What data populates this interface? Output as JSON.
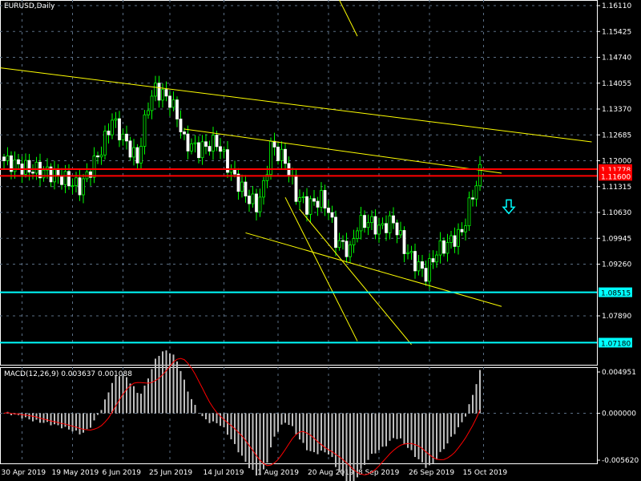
{
  "header": {
    "symbol_label": "EURUSD,Daily"
  },
  "macd": {
    "label": "MACD(12,26,9) 0.003637 0.001088",
    "axis": [
      "0.004951",
      "0.000000",
      "-0.005620"
    ],
    "range": [
      -0.00562,
      0.004951
    ]
  },
  "colors": {
    "bg": "#000000",
    "grid": "#5a6e84",
    "bull": "#00ff00",
    "bear": "#ffffff",
    "trend": "#ffff00",
    "support": "#00ffff",
    "resistance": "#ff0000",
    "signal": "#ff0000",
    "hist": "#c0c0c0"
  },
  "chart_data": {
    "type": "candlestick",
    "title": "EURUSD,Daily",
    "ylim": [
      1.0698,
      1.1625
    ],
    "price_ticks": [
      "1.16110",
      "1.15425",
      "1.14740",
      "1.14055",
      "1.13370",
      "1.12685",
      "1.12000",
      "1.11315",
      "1.10630",
      "1.09945",
      "1.09260",
      "1.07890"
    ],
    "date_ticks": [
      {
        "bar": 5,
        "label": "30 Apr 2019"
      },
      {
        "bar": 19,
        "label": "19 May 2019"
      },
      {
        "bar": 33,
        "label": "6 Jun 2019"
      },
      {
        "bar": 46,
        "label": "25 Jun 2019"
      },
      {
        "bar": 61,
        "label": "14 Jul 2019"
      },
      {
        "bar": 76,
        "label": "1 Aug 2019"
      },
      {
        "bar": 90,
        "label": "20 Aug 2019"
      },
      {
        "bar": 104,
        "label": "8 Sep 2019"
      },
      {
        "bar": 118,
        "label": "26 Sep 2019"
      },
      {
        "bar": 133,
        "label": "15 Oct 2019"
      }
    ],
    "close_path": [
      [
        0,
        1.12
      ],
      [
        6,
        1.118
      ],
      [
        12,
        1.117
      ],
      [
        17,
        1.115
      ],
      [
        21,
        1.113
      ],
      [
        23,
        1.116
      ],
      [
        27,
        1.123
      ],
      [
        30,
        1.131
      ],
      [
        33,
        1.126
      ],
      [
        37,
        1.12
      ],
      [
        40,
        1.135
      ],
      [
        42,
        1.139
      ],
      [
        46,
        1.136
      ],
      [
        48,
        1.132
      ],
      [
        50,
        1.125
      ],
      [
        54,
        1.123
      ],
      [
        59,
        1.125
      ],
      [
        63,
        1.117
      ],
      [
        67,
        1.111
      ],
      [
        70,
        1.108
      ],
      [
        72,
        1.113
      ],
      [
        74,
        1.124
      ],
      [
        78,
        1.12
      ],
      [
        81,
        1.111
      ],
      [
        84,
        1.108
      ],
      [
        88,
        1.11
      ],
      [
        90,
        1.107
      ],
      [
        92,
        1.099
      ],
      [
        96,
        1.096
      ],
      [
        98,
        1.103
      ],
      [
        101,
        1.104
      ],
      [
        104,
        1.102
      ],
      [
        108,
        1.104
      ],
      [
        111,
        1.097
      ],
      [
        114,
        1.093
      ],
      [
        117,
        1.09
      ],
      [
        120,
        1.096
      ],
      [
        123,
        1.098
      ],
      [
        127,
        1.101
      ],
      [
        129,
        1.108
      ],
      [
        132,
        1.117
      ]
    ],
    "horizontal_levels": [
      {
        "price": 1.11778,
        "label": "1.11778",
        "kind": "resistance"
      },
      {
        "price": 1.116,
        "label": "1.11600",
        "kind": "resistance"
      },
      {
        "price": 1.08515,
        "label": "1.08515",
        "kind": "support"
      },
      {
        "price": 1.0718,
        "label": "1.07180",
        "kind": "support"
      }
    ],
    "trendlines": [
      [
        [
          -1,
          1.1446
        ],
        [
          163,
          1.125
        ]
      ],
      [
        [
          50,
          1.1284
        ],
        [
          138,
          1.1167
        ]
      ],
      [
        [
          67,
          1.1009
        ],
        [
          138,
          1.0814
        ]
      ],
      [
        [
          78,
          1.1103
        ],
        [
          98,
          1.0722
        ]
      ],
      [
        [
          82,
          1.1071
        ],
        [
          113,
          1.0713
        ]
      ],
      [
        [
          93,
          1.1626
        ],
        [
          98,
          1.153
        ]
      ]
    ],
    "arrow": {
      "bar": 140,
      "price": 1.1075,
      "direction": "down"
    }
  }
}
